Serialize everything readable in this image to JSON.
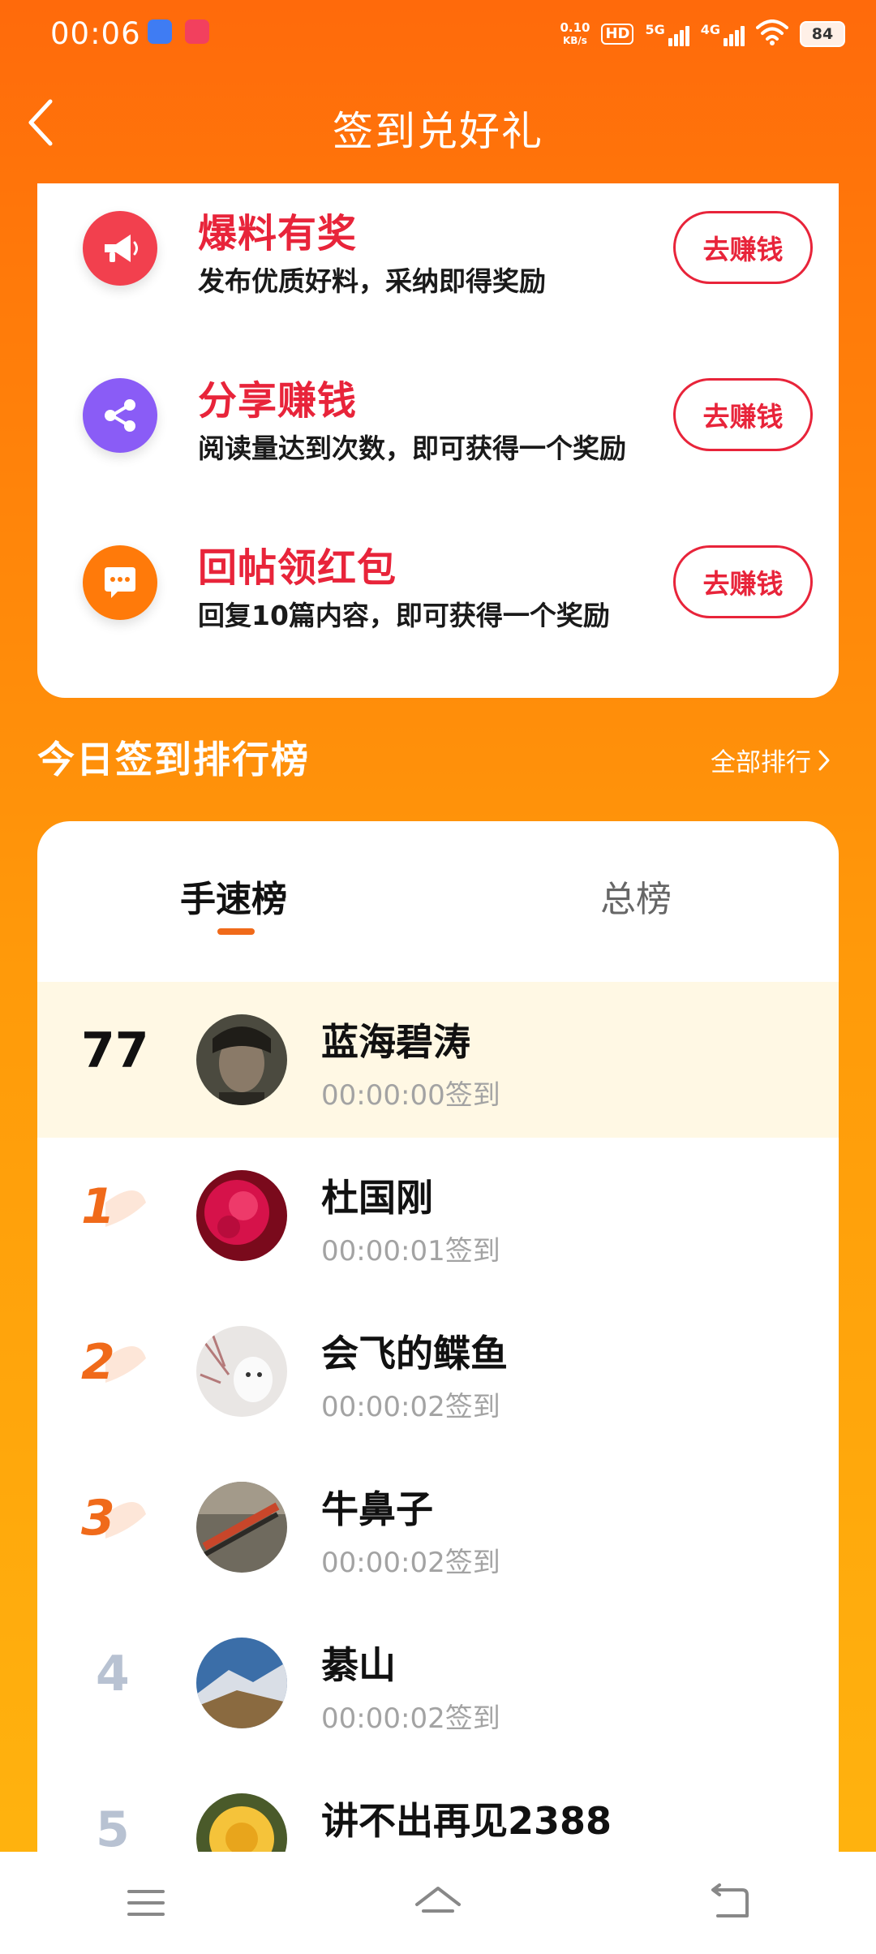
{
  "status": {
    "time": "00:06",
    "speed_value": "0.10",
    "speed_unit": "KB/s",
    "hd": "HD",
    "net1": "5G",
    "net2": "4G",
    "battery": "84"
  },
  "header": {
    "title": "签到兑好礼",
    "back_icon": "chevron-left-icon"
  },
  "tasks": [
    {
      "title": "爆料有奖",
      "desc": "发布优质好料，采纳即得奖励",
      "button": "去赚钱",
      "icon": "megaphone-icon",
      "color": "#F2404E"
    },
    {
      "title": "分享赚钱",
      "desc": "阅读量达到次数，即可获得一个奖励",
      "button": "去赚钱",
      "icon": "share-icon",
      "color": "#8A5CF6"
    },
    {
      "title": "回帖领红包",
      "desc": "回复10篇内容，即可获得一个奖励",
      "button": "去赚钱",
      "icon": "chat-icon",
      "color": "#FF7A0A"
    }
  ],
  "ranking": {
    "title": "今日签到排行榜",
    "all_link": "全部排行",
    "tabs": [
      "手速榜",
      "总榜"
    ],
    "active_tab": "手速榜",
    "rows": [
      {
        "rank": "77",
        "name": "蓝海碧涛",
        "time": "00:00:00签到",
        "self": true
      },
      {
        "rank": "1",
        "name": "杜国刚",
        "time": "00:00:01签到"
      },
      {
        "rank": "2",
        "name": "会飞的鲽鱼",
        "time": "00:00:02签到"
      },
      {
        "rank": "3",
        "name": "牛鼻子",
        "time": "00:00:02签到"
      },
      {
        "rank": "4",
        "name": "綦山",
        "time": "00:00:02签到"
      },
      {
        "rank": "5",
        "name": "讲不出再见2388",
        "time": ""
      }
    ]
  },
  "nav": {
    "menu_icon": "menu-icon",
    "home_icon": "home-icon",
    "back_icon": "back-icon"
  },
  "colors": {
    "accent": "#FF7A0A",
    "red": "#E8243A",
    "highlight_row": "#FFF8E4"
  }
}
